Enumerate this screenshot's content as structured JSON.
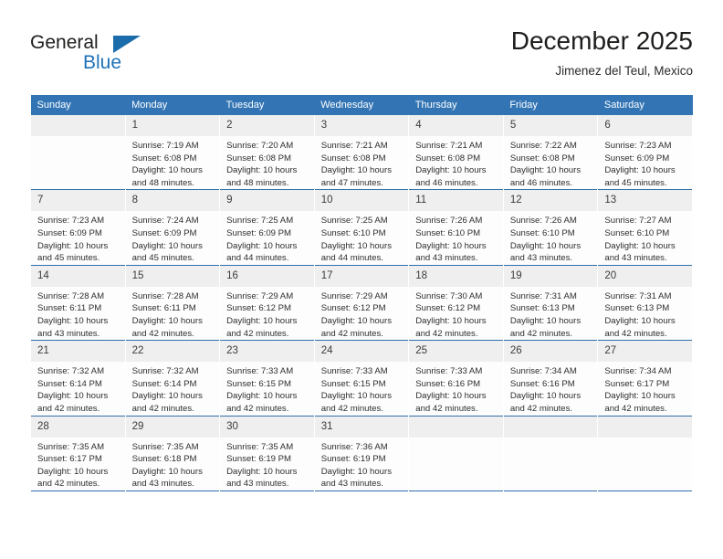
{
  "brand": {
    "name_part1": "General",
    "name_part2": "Blue",
    "logo_icon": "triangle-flag-icon",
    "accent_color": "#1d72b8"
  },
  "header": {
    "month_title": "December 2025",
    "location": "Jimenez del Teul, Mexico"
  },
  "theme": {
    "header_row_bg": "#3375b4",
    "daynum_bg": "#efefef",
    "cell_bg": "#fdfdfd",
    "week_divider": "#2f6fab",
    "text_color": "#2e2e2e"
  },
  "calendar": {
    "weekday_headers": [
      "Sunday",
      "Monday",
      "Tuesday",
      "Wednesday",
      "Thursday",
      "Friday",
      "Saturday"
    ],
    "labels": {
      "sunrise_prefix": "Sunrise:",
      "sunset_prefix": "Sunset:",
      "daylight_prefix": "Daylight:"
    },
    "weeks": [
      [
        {
          "day": "",
          "blank": true
        },
        {
          "day": "1",
          "sunrise": "Sunrise: 7:19 AM",
          "sunset": "Sunset: 6:08 PM",
          "daylight_l1": "Daylight: 10 hours",
          "daylight_l2": "and 48 minutes."
        },
        {
          "day": "2",
          "sunrise": "Sunrise: 7:20 AM",
          "sunset": "Sunset: 6:08 PM",
          "daylight_l1": "Daylight: 10 hours",
          "daylight_l2": "and 48 minutes."
        },
        {
          "day": "3",
          "sunrise": "Sunrise: 7:21 AM",
          "sunset": "Sunset: 6:08 PM",
          "daylight_l1": "Daylight: 10 hours",
          "daylight_l2": "and 47 minutes."
        },
        {
          "day": "4",
          "sunrise": "Sunrise: 7:21 AM",
          "sunset": "Sunset: 6:08 PM",
          "daylight_l1": "Daylight: 10 hours",
          "daylight_l2": "and 46 minutes."
        },
        {
          "day": "5",
          "sunrise": "Sunrise: 7:22 AM",
          "sunset": "Sunset: 6:08 PM",
          "daylight_l1": "Daylight: 10 hours",
          "daylight_l2": "and 46 minutes."
        },
        {
          "day": "6",
          "sunrise": "Sunrise: 7:23 AM",
          "sunset": "Sunset: 6:09 PM",
          "daylight_l1": "Daylight: 10 hours",
          "daylight_l2": "and 45 minutes."
        }
      ],
      [
        {
          "day": "7",
          "sunrise": "Sunrise: 7:23 AM",
          "sunset": "Sunset: 6:09 PM",
          "daylight_l1": "Daylight: 10 hours",
          "daylight_l2": "and 45 minutes."
        },
        {
          "day": "8",
          "sunrise": "Sunrise: 7:24 AM",
          "sunset": "Sunset: 6:09 PM",
          "daylight_l1": "Daylight: 10 hours",
          "daylight_l2": "and 45 minutes."
        },
        {
          "day": "9",
          "sunrise": "Sunrise: 7:25 AM",
          "sunset": "Sunset: 6:09 PM",
          "daylight_l1": "Daylight: 10 hours",
          "daylight_l2": "and 44 minutes."
        },
        {
          "day": "10",
          "sunrise": "Sunrise: 7:25 AM",
          "sunset": "Sunset: 6:10 PM",
          "daylight_l1": "Daylight: 10 hours",
          "daylight_l2": "and 44 minutes."
        },
        {
          "day": "11",
          "sunrise": "Sunrise: 7:26 AM",
          "sunset": "Sunset: 6:10 PM",
          "daylight_l1": "Daylight: 10 hours",
          "daylight_l2": "and 43 minutes."
        },
        {
          "day": "12",
          "sunrise": "Sunrise: 7:26 AM",
          "sunset": "Sunset: 6:10 PM",
          "daylight_l1": "Daylight: 10 hours",
          "daylight_l2": "and 43 minutes."
        },
        {
          "day": "13",
          "sunrise": "Sunrise: 7:27 AM",
          "sunset": "Sunset: 6:10 PM",
          "daylight_l1": "Daylight: 10 hours",
          "daylight_l2": "and 43 minutes."
        }
      ],
      [
        {
          "day": "14",
          "sunrise": "Sunrise: 7:28 AM",
          "sunset": "Sunset: 6:11 PM",
          "daylight_l1": "Daylight: 10 hours",
          "daylight_l2": "and 43 minutes."
        },
        {
          "day": "15",
          "sunrise": "Sunrise: 7:28 AM",
          "sunset": "Sunset: 6:11 PM",
          "daylight_l1": "Daylight: 10 hours",
          "daylight_l2": "and 42 minutes."
        },
        {
          "day": "16",
          "sunrise": "Sunrise: 7:29 AM",
          "sunset": "Sunset: 6:12 PM",
          "daylight_l1": "Daylight: 10 hours",
          "daylight_l2": "and 42 minutes."
        },
        {
          "day": "17",
          "sunrise": "Sunrise: 7:29 AM",
          "sunset": "Sunset: 6:12 PM",
          "daylight_l1": "Daylight: 10 hours",
          "daylight_l2": "and 42 minutes."
        },
        {
          "day": "18",
          "sunrise": "Sunrise: 7:30 AM",
          "sunset": "Sunset: 6:12 PM",
          "daylight_l1": "Daylight: 10 hours",
          "daylight_l2": "and 42 minutes."
        },
        {
          "day": "19",
          "sunrise": "Sunrise: 7:31 AM",
          "sunset": "Sunset: 6:13 PM",
          "daylight_l1": "Daylight: 10 hours",
          "daylight_l2": "and 42 minutes."
        },
        {
          "day": "20",
          "sunrise": "Sunrise: 7:31 AM",
          "sunset": "Sunset: 6:13 PM",
          "daylight_l1": "Daylight: 10 hours",
          "daylight_l2": "and 42 minutes."
        }
      ],
      [
        {
          "day": "21",
          "sunrise": "Sunrise: 7:32 AM",
          "sunset": "Sunset: 6:14 PM",
          "daylight_l1": "Daylight: 10 hours",
          "daylight_l2": "and 42 minutes."
        },
        {
          "day": "22",
          "sunrise": "Sunrise: 7:32 AM",
          "sunset": "Sunset: 6:14 PM",
          "daylight_l1": "Daylight: 10 hours",
          "daylight_l2": "and 42 minutes."
        },
        {
          "day": "23",
          "sunrise": "Sunrise: 7:33 AM",
          "sunset": "Sunset: 6:15 PM",
          "daylight_l1": "Daylight: 10 hours",
          "daylight_l2": "and 42 minutes."
        },
        {
          "day": "24",
          "sunrise": "Sunrise: 7:33 AM",
          "sunset": "Sunset: 6:15 PM",
          "daylight_l1": "Daylight: 10 hours",
          "daylight_l2": "and 42 minutes."
        },
        {
          "day": "25",
          "sunrise": "Sunrise: 7:33 AM",
          "sunset": "Sunset: 6:16 PM",
          "daylight_l1": "Daylight: 10 hours",
          "daylight_l2": "and 42 minutes."
        },
        {
          "day": "26",
          "sunrise": "Sunrise: 7:34 AM",
          "sunset": "Sunset: 6:16 PM",
          "daylight_l1": "Daylight: 10 hours",
          "daylight_l2": "and 42 minutes."
        },
        {
          "day": "27",
          "sunrise": "Sunrise: 7:34 AM",
          "sunset": "Sunset: 6:17 PM",
          "daylight_l1": "Daylight: 10 hours",
          "daylight_l2": "and 42 minutes."
        }
      ],
      [
        {
          "day": "28",
          "sunrise": "Sunrise: 7:35 AM",
          "sunset": "Sunset: 6:17 PM",
          "daylight_l1": "Daylight: 10 hours",
          "daylight_l2": "and 42 minutes."
        },
        {
          "day": "29",
          "sunrise": "Sunrise: 7:35 AM",
          "sunset": "Sunset: 6:18 PM",
          "daylight_l1": "Daylight: 10 hours",
          "daylight_l2": "and 43 minutes."
        },
        {
          "day": "30",
          "sunrise": "Sunrise: 7:35 AM",
          "sunset": "Sunset: 6:19 PM",
          "daylight_l1": "Daylight: 10 hours",
          "daylight_l2": "and 43 minutes."
        },
        {
          "day": "31",
          "sunrise": "Sunrise: 7:36 AM",
          "sunset": "Sunset: 6:19 PM",
          "daylight_l1": "Daylight: 10 hours",
          "daylight_l2": "and 43 minutes."
        },
        {
          "day": "",
          "blank": true
        },
        {
          "day": "",
          "blank": true
        },
        {
          "day": "",
          "blank": true
        }
      ]
    ]
  }
}
